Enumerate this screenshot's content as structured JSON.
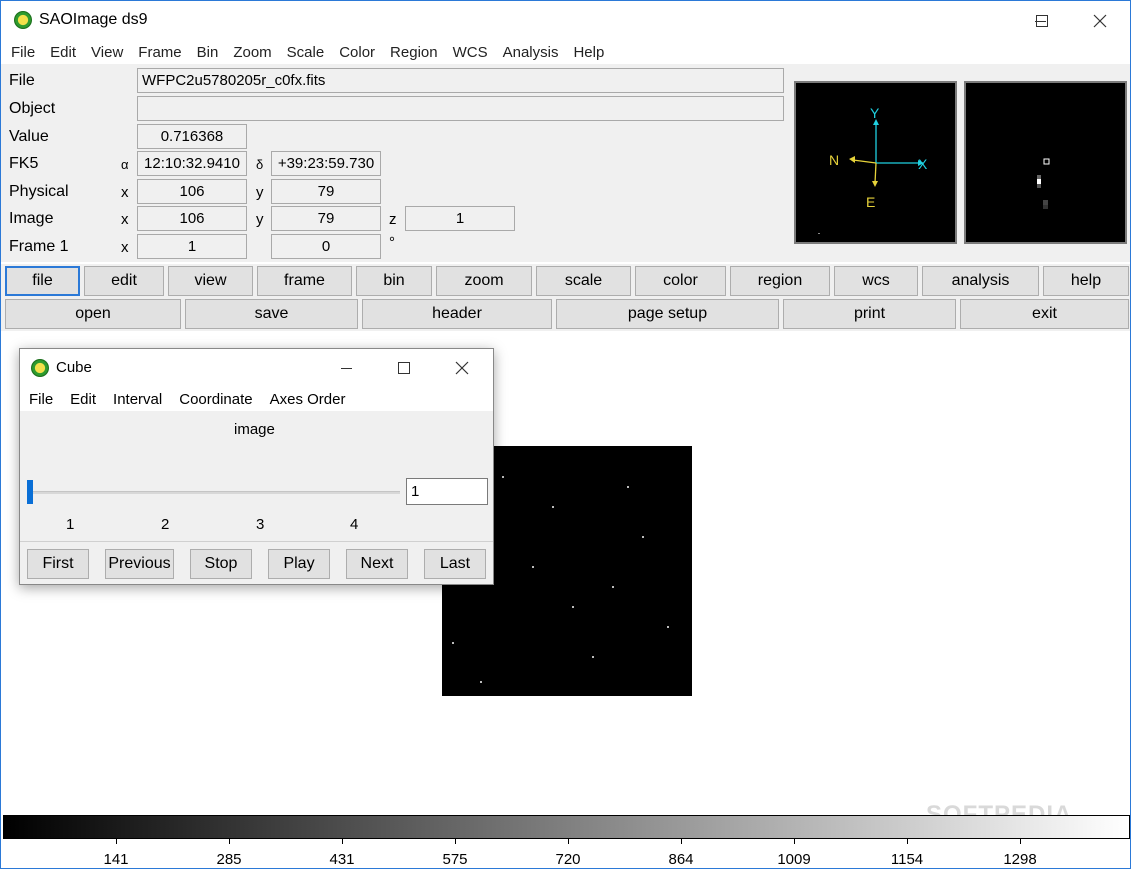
{
  "window": {
    "title": "SAOImage ds9"
  },
  "menubar": [
    "File",
    "Edit",
    "View",
    "Frame",
    "Bin",
    "Zoom",
    "Scale",
    "Color",
    "Region",
    "WCS",
    "Analysis",
    "Help"
  ],
  "info": {
    "file_label": "File",
    "file_value": "WFPC2u5780205r_c0fx.fits",
    "object_label": "Object",
    "object_value": "",
    "value_label": "Value",
    "value_value": "0.716368",
    "fk5_label": "FK5",
    "alpha": "α",
    "ra": "12:10:32.9410",
    "delta": "δ",
    "dec": "+39:23:59.730",
    "physical_label": "Physical",
    "physical_x_label": "x",
    "physical_x": "106",
    "physical_y_label": "y",
    "physical_y": "79",
    "image_label": "Image",
    "image_x_label": "x",
    "image_x": "106",
    "image_y_label": "y",
    "image_y": "79",
    "image_z_label": "z",
    "image_z": "1",
    "frame_label": "Frame 1",
    "frame_x_label": "x",
    "frame_zoom": "1",
    "frame_angle": "0",
    "degree": "°"
  },
  "compass": {
    "north": "N",
    "east": "E",
    "x": "X",
    "y": "Y"
  },
  "buttonbar": [
    "file",
    "edit",
    "view",
    "frame",
    "bin",
    "zoom",
    "scale",
    "color",
    "region",
    "wcs",
    "analysis",
    "help"
  ],
  "subbar": [
    "open",
    "save",
    "header",
    "page setup",
    "print",
    "exit"
  ],
  "colorbar": {
    "ticks": [
      "141",
      "285",
      "431",
      "575",
      "720",
      "864",
      "1009",
      "1154",
      "1298"
    ]
  },
  "cube": {
    "title": "Cube",
    "menu": [
      "File",
      "Edit",
      "Interval",
      "Coordinate",
      "Axes Order"
    ],
    "axis_label": "image",
    "slice_value": "1",
    "slider_fraction": 0,
    "slider_labels": [
      "1",
      "2",
      "3",
      "4"
    ],
    "buttons": [
      "First",
      "Previous",
      "Stop",
      "Play",
      "Next",
      "Last"
    ]
  },
  "watermark": "SOFTPEDIA"
}
